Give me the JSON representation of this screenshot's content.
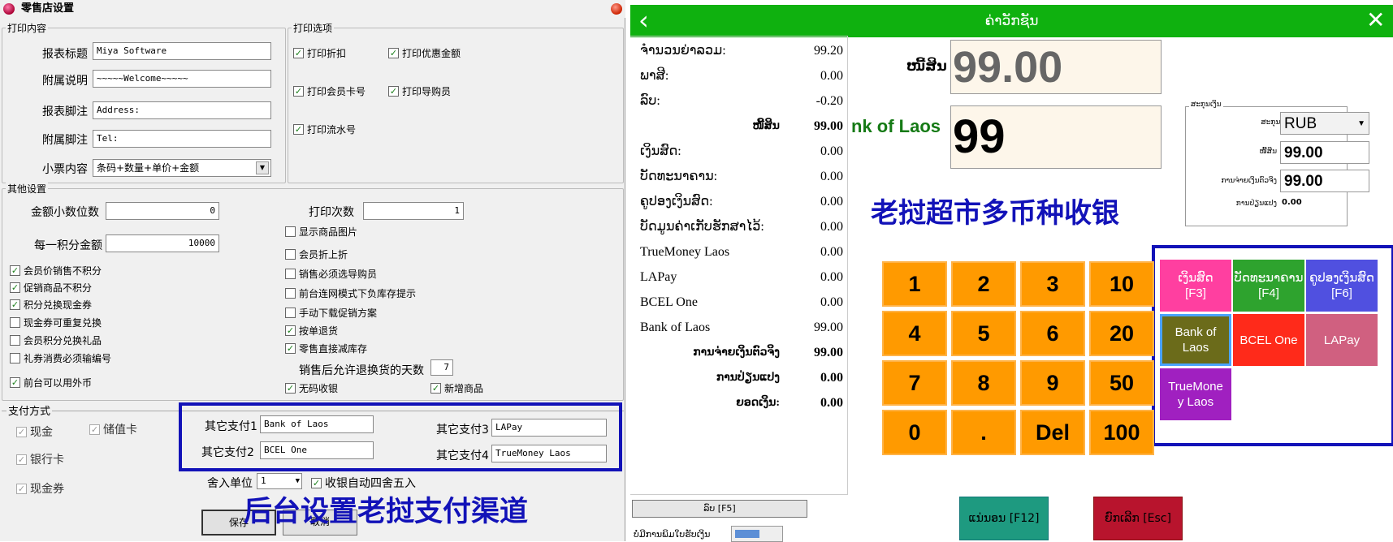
{
  "left": {
    "title": "零售店设置",
    "print_content": {
      "group_title": "打印内容",
      "fields": [
        {
          "label": "报表标题",
          "value": "Miya Software"
        },
        {
          "label": "附属说明",
          "value": "~~~~~Welcome~~~~~"
        },
        {
          "label": "报表脚注",
          "value": "Address:"
        },
        {
          "label": "附属脚注",
          "value": "Tel:"
        }
      ],
      "ticket_label": "小票内容",
      "ticket_value": "条码+数量+单价+金额"
    },
    "print_options": {
      "group_title": "打印选项",
      "items": [
        {
          "label": "打印折扣",
          "checked": "✓"
        },
        {
          "label": "打印优惠金额",
          "checked": "✓"
        },
        {
          "label": "打印会员卡号",
          "checked": "✓"
        },
        {
          "label": "打印导购员",
          "checked": "✓"
        },
        {
          "label": "打印流水号",
          "checked": "✓"
        }
      ]
    },
    "other": {
      "group_title": "其他设置",
      "decimal_label": "金额小数位数",
      "decimal_value": "0",
      "points_label": "每一积分金额",
      "points_value": "10000",
      "print_count_label": "打印次数",
      "print_count_value": "1",
      "left_checks": [
        {
          "label": "会员价销售不积分",
          "checked": "✓"
        },
        {
          "label": "促销商品不积分",
          "checked": "✓"
        },
        {
          "label": "积分兑换现金券",
          "checked": "✓"
        },
        {
          "label": "现金券可重复兑换",
          "checked": ""
        },
        {
          "label": "会员积分兑换礼品",
          "checked": ""
        },
        {
          "label": "礼券消费必须输编号",
          "checked": ""
        },
        {
          "label": "前台可以用外币",
          "checked": "✓"
        }
      ],
      "right_checks": [
        {
          "label": "显示商品图片",
          "checked": ""
        },
        {
          "label": "会员折上折",
          "checked": ""
        },
        {
          "label": "销售必须选导购员",
          "checked": ""
        },
        {
          "label": "前台连网模式下负库存提示",
          "checked": ""
        },
        {
          "label": "手动下载促销方案",
          "checked": ""
        },
        {
          "label": "按单退货",
          "checked": "✓"
        },
        {
          "label": "零售直接减库存",
          "checked": "✓"
        }
      ],
      "return_days_label": "销售后允许退换货的天数",
      "return_days_value": "7",
      "barcode_free": {
        "label": "无码收银",
        "checked": "✓"
      },
      "new_goods": {
        "label": "新增商品",
        "checked": "✓"
      }
    },
    "payment": {
      "group_title": "支付方式",
      "methods": [
        {
          "label": "现金",
          "checked": "✓"
        },
        {
          "label": "储值卡",
          "checked": "✓"
        },
        {
          "label": "银行卡",
          "checked": "✓"
        },
        {
          "label": "现金券",
          "checked": "✓"
        }
      ],
      "other_pay": [
        {
          "label": "其它支付1",
          "value": "Bank of Laos"
        },
        {
          "label": "其它支付2",
          "value": "BCEL One"
        },
        {
          "label": "其它支付3",
          "value": "LAPay"
        },
        {
          "label": "其它支付4",
          "value": "TrueMoney Laos"
        }
      ],
      "round_unit_label": "舍入单位",
      "round_unit_value": "1",
      "auto_round": {
        "label": "收银自动四舍五入",
        "checked": "✓"
      }
    },
    "save_label": "保存",
    "cancel_label": "取消",
    "caption": "后台设置老挝支付渠道"
  },
  "right": {
    "title": "ຄ່າວັກຊັນ",
    "summary": [
      {
        "key": "ຈຳນວນຍ່າລວມ:",
        "value": "99.20",
        "bold": false
      },
      {
        "key": "ພາສີ:",
        "value": "0.00",
        "bold": false
      },
      {
        "key": "ລົບ:",
        "value": "-0.20",
        "bold": false
      },
      {
        "key": "ໜີ້ສິນ",
        "value": "99.00",
        "bold": true
      },
      {
        "key": "ເງິນສົດ:",
        "value": "0.00",
        "bold": false
      },
      {
        "key": "ບັດທະນາຄານ:",
        "value": "0.00",
        "bold": false
      },
      {
        "key": "ຄູປອງເງິນສົດ:",
        "value": "0.00",
        "bold": false
      },
      {
        "key": "ບັດມູນຄ່າເກັບຮັກສາໄວ້:",
        "value": "0.00",
        "bold": false
      },
      {
        "key": "TrueMoney Laos",
        "value": "0.00",
        "bold": false
      },
      {
        "key": "LAPay",
        "value": "0.00",
        "bold": false
      },
      {
        "key": "BCEL One",
        "value": "0.00",
        "bold": false
      },
      {
        "key": "Bank of Laos",
        "value": "99.00",
        "bold": false
      },
      {
        "key": "ການຈ່າຍເງິນຕົວຈິງ",
        "value": "99.00",
        "bold": true
      },
      {
        "key": "ການປ່ຽນແປງ",
        "value": "0.00",
        "bold": true
      },
      {
        "key": "ຍອດເງິນ:",
        "value": "0.00",
        "bold": true
      }
    ],
    "debt_label": "ໜີ້ສິນ",
    "debt_value": "99.00",
    "method_label": "nk of Laos",
    "method_value": "99",
    "caption": "老挝超市多币种收银",
    "currency_panel": {
      "title": "ສະກຸນເງິນ",
      "currency_label": "ສະກຸນເງິນ",
      "currency_value": "RUB",
      "debt_label": "ໜີ້ສິນ",
      "debt_value": "99.00",
      "actual_label": "ການຈ່າຍເງິນຕົວຈິງ",
      "actual_value": "99.00",
      "change_label": "ການປ່ຽນແປງ",
      "change_value": "0.00"
    },
    "keypad": [
      "1",
      "2",
      "3",
      "10",
      "4",
      "5",
      "6",
      "20",
      "7",
      "8",
      "9",
      "50",
      "0",
      ".",
      "Del",
      "100"
    ],
    "pay_buttons": [
      {
        "label": "ເງິນສົດ\n[F3]",
        "color": "#ff3fa0"
      },
      {
        "label": "ບັດທະນາຄານ\n[F4]",
        "color": "#2ea32e"
      },
      {
        "label": "ຄູປອງເງິນສົດ\n[F6]",
        "color": "#5050e0"
      },
      {
        "label": "Bank of\nLaos",
        "color": "#6b6b1a"
      },
      {
        "label": "BCEL One",
        "color": "#ff2a1a"
      },
      {
        "label": "LAPay",
        "color": "#d06080"
      },
      {
        "label": "TrueMone\ny Laos",
        "color": "#a020c0"
      }
    ],
    "minus_btn": "ລົບ [F5]",
    "confirm_btn": "ແນ່ນອນ [F12]",
    "cancel_btn": "ຍົກເລີກ [Esc]",
    "print_toggle_label": "ບໍ່ມີການພິມໃບຮັບເງິນ"
  },
  "colors": {
    "green": "#0fb10f",
    "blue_frame": "#1212b8",
    "orange": "#ff9a00"
  }
}
